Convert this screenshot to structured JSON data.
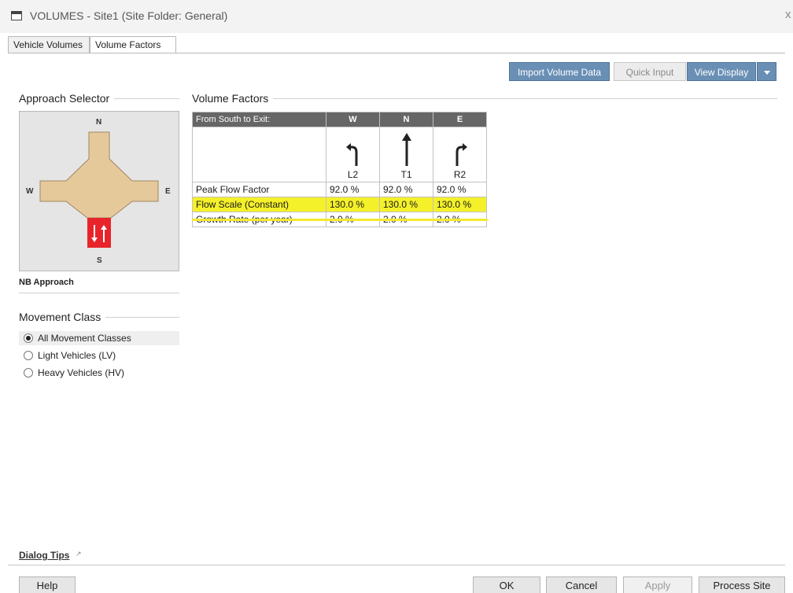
{
  "window": {
    "title": "VOLUMES - Site1 (Site Folder: General)",
    "close_glyph": "x"
  },
  "tabs": [
    {
      "label": "Vehicle Volumes"
    },
    {
      "label": "Volume Factors"
    }
  ],
  "toolbar": {
    "import_label": "Import Volume Data",
    "quick_input_label": "Quick Input",
    "view_display_label": "View Display"
  },
  "approach_selector": {
    "heading": "Approach Selector",
    "compass": {
      "n": "N",
      "s": "S",
      "e": "E",
      "w": "W"
    },
    "selected_approach": "NB Approach"
  },
  "movement_class": {
    "heading": "Movement Class",
    "options": [
      {
        "label": "All Movement Classes",
        "selected": true
      },
      {
        "label": "Light Vehicles (LV)",
        "selected": false
      },
      {
        "label": "Heavy Vehicles (HV)",
        "selected": false
      }
    ]
  },
  "volume_factors": {
    "heading": "Volume Factors",
    "header_label": "From South to Exit:",
    "exits": [
      "W",
      "N",
      "E"
    ],
    "movement_codes": [
      "L2",
      "T1",
      "R2"
    ],
    "rows": [
      {
        "label": "Peak Flow Factor",
        "values": [
          "92.0 %",
          "92.0 %",
          "92.0 %"
        ],
        "highlighted": false
      },
      {
        "label": "Flow Scale (Constant)",
        "values": [
          "130.0 %",
          "130.0 %",
          "130.0 %"
        ],
        "highlighted": true
      },
      {
        "label": "Growth Rate (per year)",
        "values": [
          "2.0 %",
          "2.0 %",
          "2.0 %"
        ],
        "highlighted": false
      }
    ]
  },
  "footer": {
    "dialog_tips": "Dialog Tips",
    "help": "Help",
    "ok": "OK",
    "cancel": "Cancel",
    "apply": "Apply",
    "process_site": "Process Site"
  },
  "colors": {
    "intersection_fill": "#e6c99b",
    "approach_selected": "#e8242b",
    "highlight": "#f4f02a",
    "table_header": "#666666",
    "button_blue": "#6a8fb5"
  }
}
